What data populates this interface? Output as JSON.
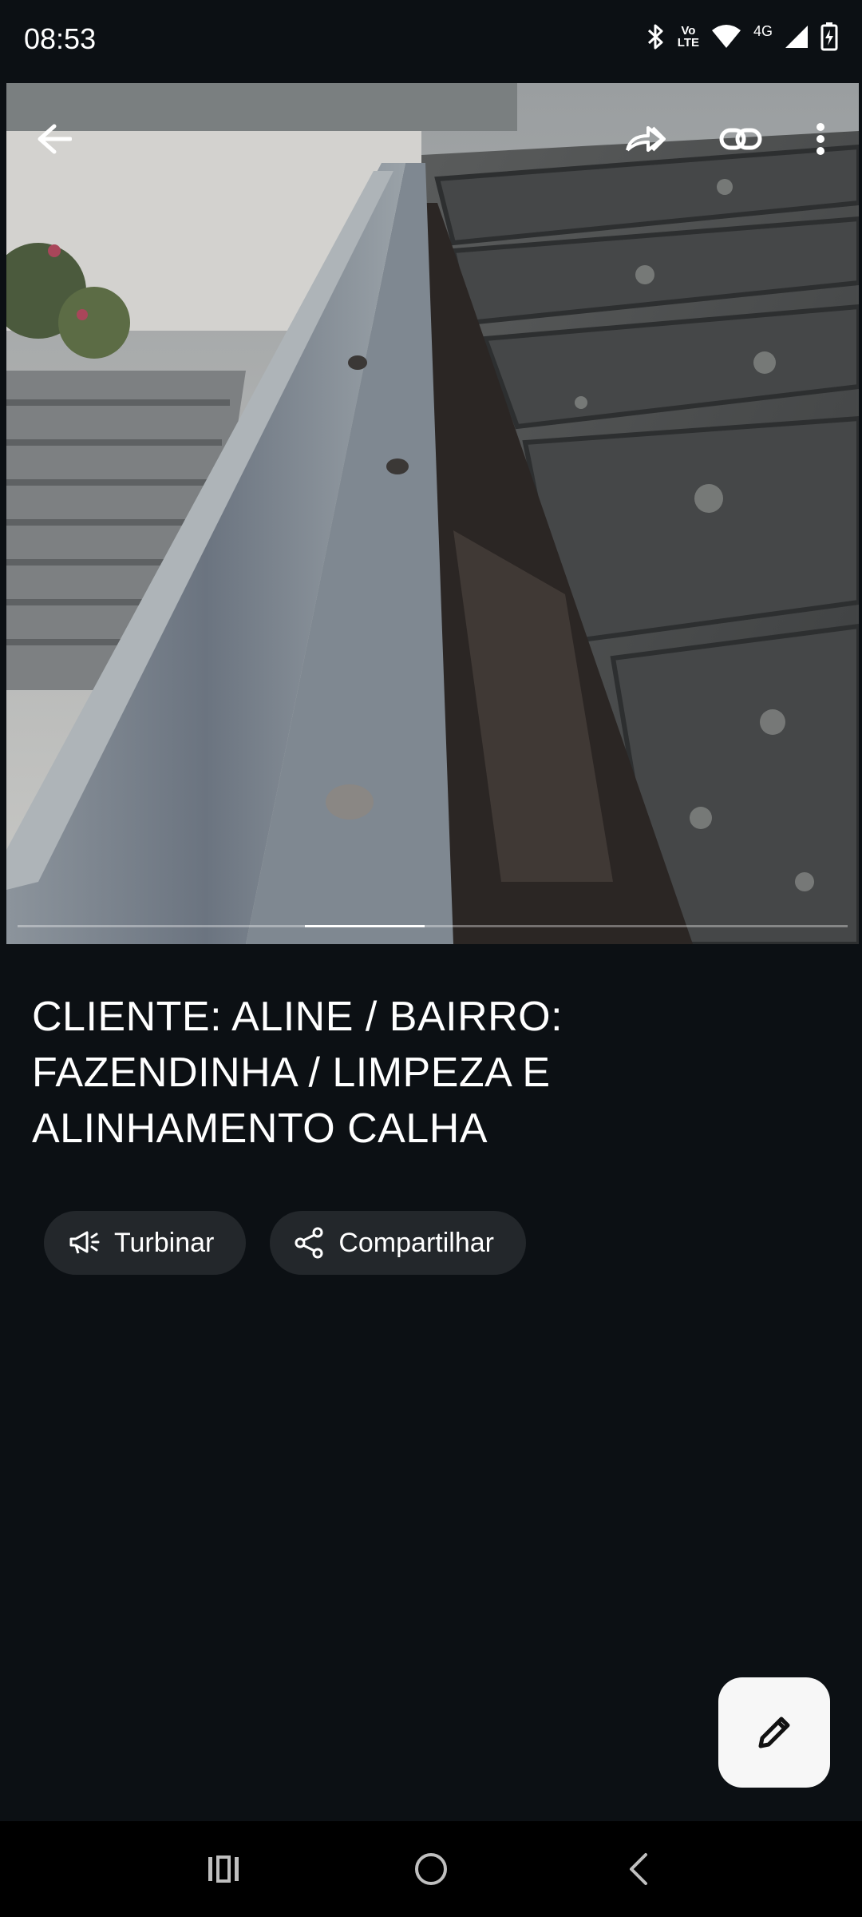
{
  "status_bar": {
    "time": "08:53",
    "network_label": "4G",
    "volte_label": "Vo LTE",
    "icons": [
      "bluetooth-icon",
      "volte-icon",
      "wifi-icon",
      "signal-icon",
      "battery-charging-icon"
    ]
  },
  "photo": {
    "description_icons": [
      "back-arrow-icon",
      "share-forward-icon",
      "link-icon",
      "more-vert-icon"
    ],
    "progress": {
      "current": 2,
      "total": 4
    }
  },
  "post": {
    "title": "CLIENTE: ALINE / BAIRRO: FAZENDINHA / LIMPEZA E ALINHAMENTO CALHA"
  },
  "actions": {
    "boost_label": "Turbinar",
    "share_label": "Compartilhar"
  },
  "fab": {
    "icon": "edit-pencil-icon"
  },
  "nav": {
    "icons": [
      "recent-apps-icon",
      "home-icon",
      "back-icon"
    ]
  },
  "colors": {
    "background": "#0c1014",
    "chip": "#23272b",
    "fab": "#f7f7f7",
    "nav": "#000000"
  }
}
